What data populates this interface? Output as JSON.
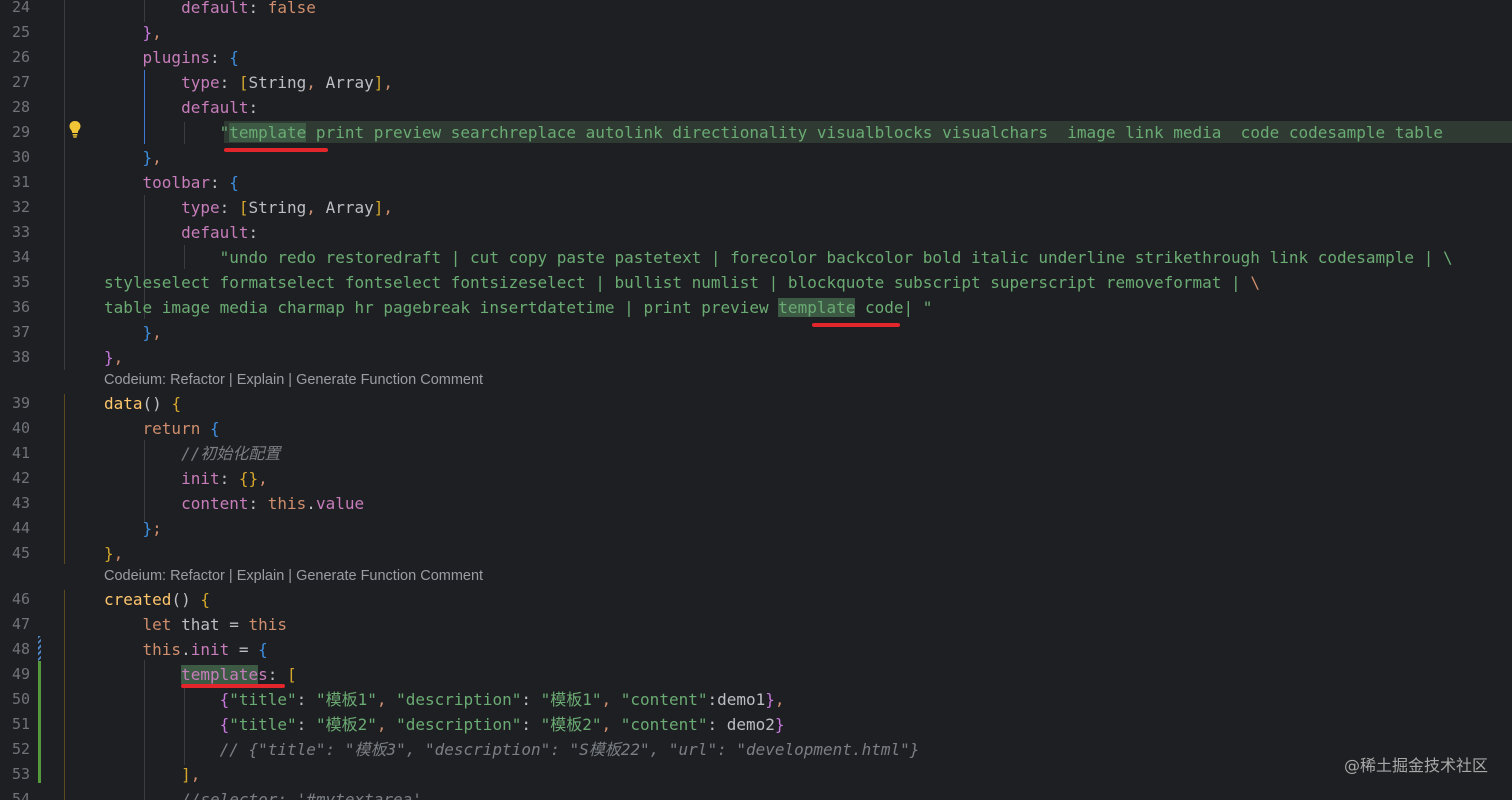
{
  "lines": [
    {
      "num": "24",
      "code": [
        {
          "t": "        ",
          "c": "pl"
        },
        {
          "t": "default",
          "c": "prop"
        },
        {
          "t": ": ",
          "c": "pl"
        },
        {
          "t": "false",
          "c": "kw"
        }
      ]
    },
    {
      "num": "25",
      "code": [
        {
          "t": "    ",
          "c": "pl"
        },
        {
          "t": "}",
          "c": "b2"
        },
        {
          "t": ",",
          "c": "kw"
        }
      ]
    },
    {
      "num": "26",
      "code": [
        {
          "t": "    ",
          "c": "pl"
        },
        {
          "t": "plugins",
          "c": "prop"
        },
        {
          "t": ": ",
          "c": "pl"
        },
        {
          "t": "{",
          "c": "b3"
        }
      ]
    },
    {
      "num": "27",
      "code": [
        {
          "t": "        ",
          "c": "pl"
        },
        {
          "t": "type",
          "c": "prop"
        },
        {
          "t": ": ",
          "c": "pl"
        },
        {
          "t": "[",
          "c": "b1"
        },
        {
          "t": "String",
          "c": "pl"
        },
        {
          "t": ", ",
          "c": "kw"
        },
        {
          "t": "Array",
          "c": "pl"
        },
        {
          "t": "]",
          "c": "b1"
        },
        {
          "t": ",",
          "c": "kw"
        }
      ]
    },
    {
      "num": "28",
      "code": [
        {
          "t": "        ",
          "c": "pl"
        },
        {
          "t": "default",
          "c": "prop"
        },
        {
          "t": ":",
          "c": "pl"
        }
      ]
    },
    {
      "num": "29",
      "code": [
        {
          "t": "            ",
          "c": "pl"
        },
        {
          "t": "\"",
          "c": "str"
        },
        {
          "t": "template",
          "c": "str",
          "hl": true
        },
        {
          "t": " print preview searchreplace autolink directionality visualblocks visualchars  image link media  code codesample table",
          "c": "str"
        }
      ]
    },
    {
      "num": "30",
      "code": [
        {
          "t": "    ",
          "c": "pl"
        },
        {
          "t": "}",
          "c": "b3"
        },
        {
          "t": ",",
          "c": "kw"
        }
      ]
    },
    {
      "num": "31",
      "code": [
        {
          "t": "    ",
          "c": "pl"
        },
        {
          "t": "toolbar",
          "c": "prop"
        },
        {
          "t": ": ",
          "c": "pl"
        },
        {
          "t": "{",
          "c": "b3"
        }
      ]
    },
    {
      "num": "32",
      "code": [
        {
          "t": "        ",
          "c": "pl"
        },
        {
          "t": "type",
          "c": "prop"
        },
        {
          "t": ": ",
          "c": "pl"
        },
        {
          "t": "[",
          "c": "b1"
        },
        {
          "t": "String",
          "c": "pl"
        },
        {
          "t": ", ",
          "c": "kw"
        },
        {
          "t": "Array",
          "c": "pl"
        },
        {
          "t": "]",
          "c": "b1"
        },
        {
          "t": ",",
          "c": "kw"
        }
      ]
    },
    {
      "num": "33",
      "code": [
        {
          "t": "        ",
          "c": "pl"
        },
        {
          "t": "default",
          "c": "prop"
        },
        {
          "t": ":",
          "c": "pl"
        }
      ]
    },
    {
      "num": "34",
      "code": [
        {
          "t": "            ",
          "c": "pl"
        },
        {
          "t": "\"undo redo restoredraft | cut copy paste pastetext | forecolor backcolor bold italic underline strikethrough link codesample | \\",
          "c": "str"
        }
      ]
    },
    {
      "num": "35",
      "code": [
        {
          "t": "styleselect formatselect fontselect fontsizeselect | bullist numlist | blockquote subscript superscript removeformat | ",
          "c": "str"
        },
        {
          "t": "\\",
          "c": "kw"
        }
      ]
    },
    {
      "num": "36",
      "code": [
        {
          "t": "table image media charmap hr pagebreak insertdatetime | print preview ",
          "c": "str"
        },
        {
          "t": "template",
          "c": "str",
          "hl": true
        },
        {
          "t": " code| \"",
          "c": "str"
        }
      ]
    },
    {
      "num": "37",
      "code": [
        {
          "t": "    ",
          "c": "pl"
        },
        {
          "t": "}",
          "c": "b3"
        },
        {
          "t": ",",
          "c": "kw"
        }
      ]
    },
    {
      "num": "38",
      "code": [
        {
          "t": "}",
          "c": "b2"
        },
        {
          "t": ",",
          "c": "kw"
        }
      ]
    },
    {
      "num": "39",
      "code": [
        {
          "t": "data",
          "c": "fn"
        },
        {
          "t": "() ",
          "c": "pl"
        },
        {
          "t": "{",
          "c": "b1"
        }
      ]
    },
    {
      "num": "40",
      "code": [
        {
          "t": "    ",
          "c": "pl"
        },
        {
          "t": "return",
          "c": "kw"
        },
        {
          "t": " ",
          "c": "pl"
        },
        {
          "t": "{",
          "c": "b3"
        }
      ]
    },
    {
      "num": "41",
      "code": [
        {
          "t": "        ",
          "c": "pl"
        },
        {
          "t": "//初始化配置",
          "c": "cm"
        }
      ]
    },
    {
      "num": "42",
      "code": [
        {
          "t": "        ",
          "c": "pl"
        },
        {
          "t": "init",
          "c": "prop"
        },
        {
          "t": ": ",
          "c": "pl"
        },
        {
          "t": "{}",
          "c": "b1"
        },
        {
          "t": ",",
          "c": "kw"
        }
      ]
    },
    {
      "num": "43",
      "code": [
        {
          "t": "        ",
          "c": "pl"
        },
        {
          "t": "content",
          "c": "prop"
        },
        {
          "t": ": ",
          "c": "pl"
        },
        {
          "t": "this",
          "c": "kw"
        },
        {
          "t": ".",
          "c": "pl"
        },
        {
          "t": "value",
          "c": "prop"
        }
      ]
    },
    {
      "num": "44",
      "code": [
        {
          "t": "    ",
          "c": "pl"
        },
        {
          "t": "}",
          "c": "b3"
        },
        {
          "t": ";",
          "c": "kw"
        }
      ]
    },
    {
      "num": "45",
      "code": [
        {
          "t": "}",
          "c": "b1"
        },
        {
          "t": ",",
          "c": "kw"
        }
      ]
    },
    {
      "num": "46",
      "code": [
        {
          "t": "created",
          "c": "fn"
        },
        {
          "t": "() ",
          "c": "pl"
        },
        {
          "t": "{",
          "c": "b1"
        }
      ]
    },
    {
      "num": "47",
      "code": [
        {
          "t": "    ",
          "c": "pl"
        },
        {
          "t": "let",
          "c": "kw"
        },
        {
          "t": " that = ",
          "c": "pl"
        },
        {
          "t": "this",
          "c": "kw"
        }
      ]
    },
    {
      "num": "48",
      "code": [
        {
          "t": "    ",
          "c": "pl"
        },
        {
          "t": "this",
          "c": "kw"
        },
        {
          "t": ".",
          "c": "pl"
        },
        {
          "t": "init",
          "c": "prop"
        },
        {
          "t": " = ",
          "c": "pl"
        },
        {
          "t": "{",
          "c": "b3"
        }
      ]
    },
    {
      "num": "49",
      "code": [
        {
          "t": "        ",
          "c": "pl"
        },
        {
          "t": "template",
          "c": "prop",
          "hl": true
        },
        {
          "t": "s",
          "c": "prop"
        },
        {
          "t": ": ",
          "c": "pl"
        },
        {
          "t": "[",
          "c": "b1"
        }
      ]
    },
    {
      "num": "50",
      "code": [
        {
          "t": "            ",
          "c": "pl"
        },
        {
          "t": "{",
          "c": "b2"
        },
        {
          "t": "\"title\"",
          "c": "str"
        },
        {
          "t": ": ",
          "c": "pl"
        },
        {
          "t": "\"模板1\"",
          "c": "str"
        },
        {
          "t": ", ",
          "c": "kw"
        },
        {
          "t": "\"description\"",
          "c": "str"
        },
        {
          "t": ": ",
          "c": "pl"
        },
        {
          "t": "\"模板1\"",
          "c": "str"
        },
        {
          "t": ", ",
          "c": "kw"
        },
        {
          "t": "\"content\"",
          "c": "str"
        },
        {
          "t": ":demo1",
          "c": "pl"
        },
        {
          "t": "}",
          "c": "b2"
        },
        {
          "t": ",",
          "c": "kw"
        }
      ]
    },
    {
      "num": "51",
      "code": [
        {
          "t": "            ",
          "c": "pl"
        },
        {
          "t": "{",
          "c": "b2"
        },
        {
          "t": "\"title\"",
          "c": "str"
        },
        {
          "t": ": ",
          "c": "pl"
        },
        {
          "t": "\"模板2\"",
          "c": "str"
        },
        {
          "t": ", ",
          "c": "kw"
        },
        {
          "t": "\"description\"",
          "c": "str"
        },
        {
          "t": ": ",
          "c": "pl"
        },
        {
          "t": "\"模板2\"",
          "c": "str"
        },
        {
          "t": ", ",
          "c": "kw"
        },
        {
          "t": "\"content\"",
          "c": "str"
        },
        {
          "t": ": demo2",
          "c": "pl"
        },
        {
          "t": "}",
          "c": "b2"
        }
      ]
    },
    {
      "num": "52",
      "code": [
        {
          "t": "            ",
          "c": "pl"
        },
        {
          "t": "// {\"title\": \"模板3\", \"description\": \"S模板22\", \"url\": \"development.html\"}",
          "c": "cm"
        }
      ]
    },
    {
      "num": "53",
      "code": [
        {
          "t": "        ",
          "c": "pl"
        },
        {
          "t": "]",
          "c": "b1"
        },
        {
          "t": ",",
          "c": "kw"
        }
      ]
    },
    {
      "num": "54",
      "code": [
        {
          "t": "        ",
          "c": "pl"
        },
        {
          "t": "//selector: '#mytextarea',",
          "c": "cm"
        }
      ]
    }
  ],
  "codelens": {
    "data": "Codeium: Refactor | Explain | Generate Function Comment",
    "created": "Codeium: Refactor | Explain | Generate Function Comment"
  },
  "icons": {
    "bulb": "lightbulb-icon"
  },
  "colors": {
    "background": "#1e1f22",
    "keyword": "#cf8e6d",
    "property": "#c77dbb",
    "string": "#6aab73",
    "function": "#ffc66d",
    "annotation_underline": "#e3262b"
  },
  "watermark": "@稀土掘金技术社区"
}
